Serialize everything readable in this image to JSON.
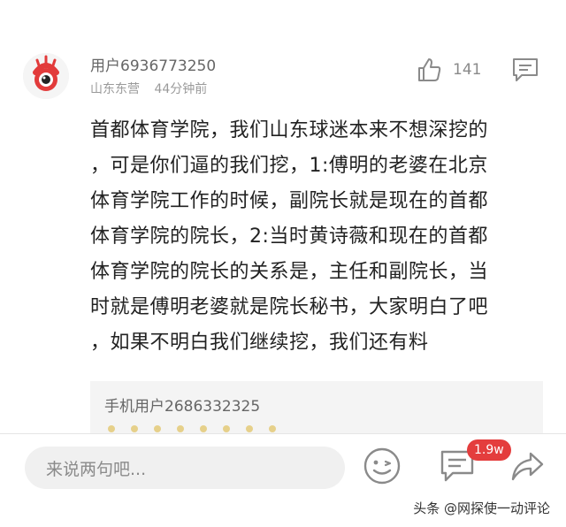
{
  "comment": {
    "username": "用户6936773250",
    "location": "山东东营",
    "time": "44分钟前",
    "like_count": "141",
    "body_lines": [
      "首都体育学院，我们山东球迷本来不想深挖的",
      "，可是你们逼的我们挖，1:傅明的老婆在北京",
      "体育学院工作的时候，副院长就是现在的首都",
      "体育学院的院长，2:当时黄诗薇和现在的首都",
      "体育学院的院长的关系是，主任和副院长，当",
      "时就是傅明老婆就是院长秘书，大家明白了吧",
      "，如果不明白我们继续挖，我们还有料"
    ],
    "reply_preview": {
      "username": "手机用户2686332325"
    }
  },
  "bottom_bar": {
    "input_placeholder": "来说两句吧...",
    "comment_badge": "1.9w"
  },
  "watermark": "头条 @网探使一动评论",
  "icons": {
    "avatar": "weibo-eye-avatar",
    "like": "thumbs-up-icon",
    "reply": "comment-icon",
    "emoji": "emoji-icon",
    "comments": "comments-icon",
    "share": "share-icon"
  },
  "colors": {
    "badge": "#e43d3d",
    "avatar_red": "#e23b3b"
  }
}
